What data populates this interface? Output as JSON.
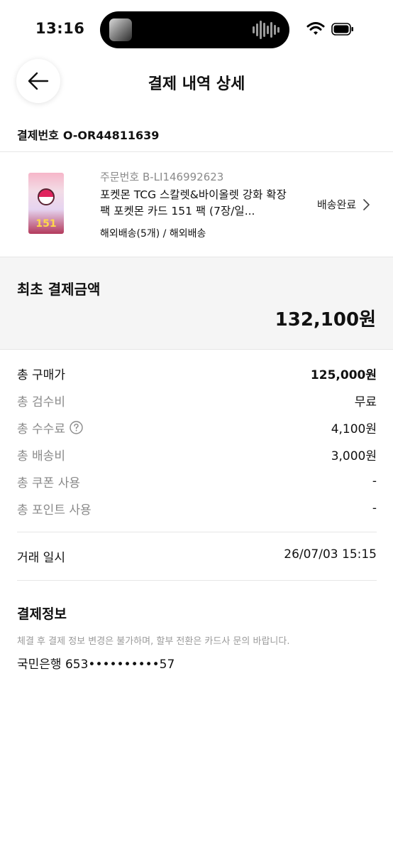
{
  "status_bar": {
    "time": "13:16"
  },
  "header": {
    "title": "결제 내역 상세"
  },
  "payment": {
    "label": "결제번호",
    "number": "O-OR44811639"
  },
  "order": {
    "order_number": "주문번호 B-LI146992623",
    "product_name": "포켓몬 TCG 스칼렛&바이올렛 강화 확장팩 포켓몬 카드 151 팩 (7장/일...",
    "shipping": "해외배송(5개) / 해외배송",
    "status": "배송완료",
    "thumb_text": "151"
  },
  "total": {
    "label": "최초 결제금액",
    "amount": "132,100원"
  },
  "breakdown": [
    {
      "label": "총 구매가",
      "value": "125,000원"
    },
    {
      "label": "총 검수비",
      "value": "무료"
    },
    {
      "label": "총 수수료",
      "value": "4,100원"
    },
    {
      "label": "총 배송비",
      "value": "3,000원"
    },
    {
      "label": "총 쿠폰 사용",
      "value": "-"
    },
    {
      "label": "총 포인트 사용",
      "value": "-"
    }
  ],
  "trade": {
    "label": "거래 일시",
    "value": "26/07/03 15:15"
  },
  "payment_info": {
    "title": "결제정보",
    "note": "체결 후 결제 정보 변경은 불가하며, 할부 전환은 카드사 문의 바랍니다.",
    "account": "국민은행 653••••••••••57"
  },
  "colors": {
    "text": "#111111",
    "muted": "#8a8a8a",
    "panel": "#f5f5f5"
  }
}
